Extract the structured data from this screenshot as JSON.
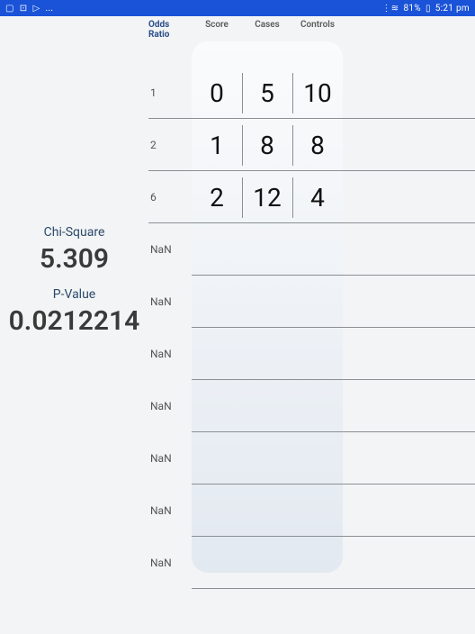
{
  "status_bar": {
    "left_icons": [
      "▢",
      "⊡",
      "▷",
      "..."
    ],
    "battery": "81%",
    "time": "5:21 pm"
  },
  "stats": {
    "chi_label": "Chi-Square",
    "chi_value": "5.309",
    "p_label": "P-Value",
    "p_value": "0.0212214"
  },
  "headers": {
    "odds": "Odds Ratio",
    "score": "Score",
    "cases": "Cases",
    "controls": "Controls"
  },
  "rows": [
    {
      "or": "1",
      "score": "0",
      "cases": "5",
      "controls": "10",
      "filled": true
    },
    {
      "or": "2",
      "score": "1",
      "cases": "8",
      "controls": "8",
      "filled": true
    },
    {
      "or": "6",
      "score": "2",
      "cases": "12",
      "controls": "4",
      "filled": true
    },
    {
      "or": "NaN",
      "score": "",
      "cases": "",
      "controls": "",
      "filled": false
    },
    {
      "or": "NaN",
      "score": "",
      "cases": "",
      "controls": "",
      "filled": false
    },
    {
      "or": "NaN",
      "score": "",
      "cases": "",
      "controls": "",
      "filled": false
    },
    {
      "or": "NaN",
      "score": "",
      "cases": "",
      "controls": "",
      "filled": false
    },
    {
      "or": "NaN",
      "score": "",
      "cases": "",
      "controls": "",
      "filled": false
    },
    {
      "or": "NaN",
      "score": "",
      "cases": "",
      "controls": "",
      "filled": false
    },
    {
      "or": "NaN",
      "score": "",
      "cases": "",
      "controls": "",
      "filled": false
    }
  ]
}
